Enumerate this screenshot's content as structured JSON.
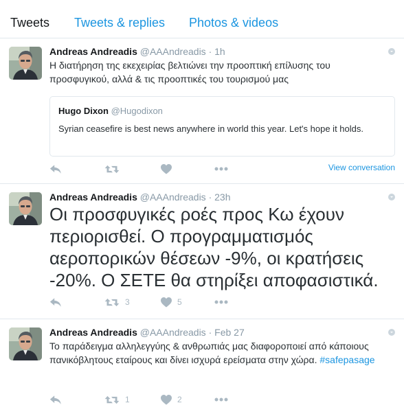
{
  "tabs": {
    "tweets": "Tweets",
    "replies": "Tweets & replies",
    "media": "Photos & videos"
  },
  "tweets": [
    {
      "name": "Andreas Andreadis",
      "handle": "@AAAndreadis",
      "dot": "·",
      "time": "1h",
      "text": "Η διατήρηση της εκεχειρίας βελτιώνει την προοπτική επίλυσης του προσφυγικού, αλλά & τις προοπτικές του τουρισμού μας",
      "quote": {
        "name": "Hugo Dixon",
        "handle": "@Hugodixon",
        "text": "Syrian ceasefire is best news anywhere in world this year. Let's hope it holds."
      },
      "retweets": "",
      "likes": "",
      "view_conversation": "View conversation"
    },
    {
      "name": "Andreas Andreadis",
      "handle": "@AAAndreadis",
      "dot": "·",
      "time": "23h",
      "text": "Οι προσφυγικές ροές προς Κω έχουν περιορισθεί. Ο προγραμματισμός αεροπορικών θέσεων -9%, οι κρατήσεις -20%. Ο ΣΕΤΕ θα στηρίξει αποφασιστικά.",
      "retweets": "3",
      "likes": "5"
    },
    {
      "name": "Andreas Andreadis",
      "handle": "@AAAndreadis",
      "dot": "·",
      "time": "Feb 27",
      "text": "Το παράδειγμα αλληλεγγύης & ανθρωπιάς μας διαφοροποιεί από κάποιους πανικόβλητους εταίρους και δίνει ισχυρά ερείσματα στην χώρα.",
      "hashtag": "#safepasage",
      "retweets": "1",
      "likes": "2"
    }
  ],
  "icons": {
    "reply": "reply-icon",
    "retweet": "retweet-icon",
    "like": "heart-icon",
    "more": "more-icon",
    "caret": "caret-down-icon"
  },
  "colors": {
    "link": "#1b95e0",
    "action": "#aab8c2",
    "border": "#e1e8ed"
  }
}
